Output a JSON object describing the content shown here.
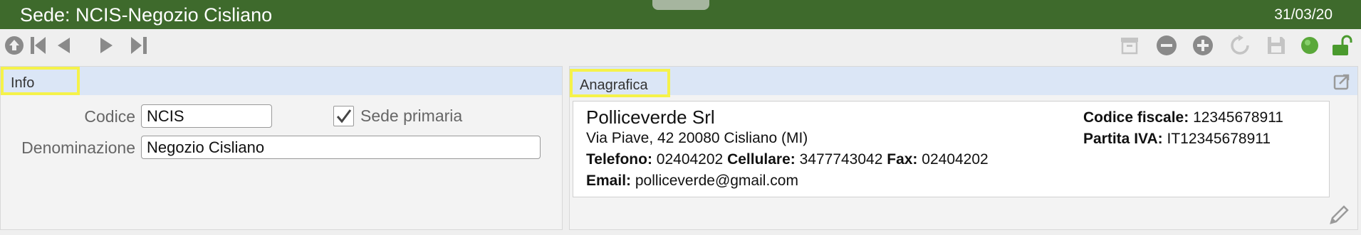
{
  "window": {
    "title": "Sede: NCIS-Negozio Cisliano",
    "date": "31/03/20"
  },
  "toolbar": {
    "left_icons": [
      "up-circle-icon",
      "first-record-icon",
      "previous-record-icon",
      "next-record-icon",
      "last-record-icon"
    ],
    "right_icons": [
      "archive-icon",
      "remove-icon",
      "add-icon",
      "refresh-icon",
      "save-icon",
      "status-indicator-icon",
      "unlock-icon"
    ],
    "colors": {
      "icon_gray": "#8a8a8a",
      "status_green": "#5aa83a"
    }
  },
  "info_panel": {
    "tab_label": "Info",
    "codice_label": "Codice",
    "codice_value": "NCIS",
    "sede_primaria_label": "Sede primaria",
    "sede_primaria_checked": true,
    "denominazione_label": "Denominazione",
    "denominazione_value": "Negozio Cisliano"
  },
  "anagrafica_panel": {
    "tab_label": "Anagrafica",
    "company_name": "Polliceverde Srl",
    "address": "Via Piave, 42 20080 Cisliano (MI)",
    "telefono_label": "Telefono:",
    "telefono_value": "02404202",
    "cellulare_label": "Cellulare:",
    "cellulare_value": "3477743042",
    "fax_label": "Fax:",
    "fax_value": "02404202",
    "email_label": "Email:",
    "email_value": "polliceverde@gmail.com",
    "codice_fiscale_label": "Codice fiscale:",
    "codice_fiscale_value": "12345678911",
    "partita_iva_label": "Partita IVA:",
    "partita_iva_value": "IT12345678911"
  },
  "colors": {
    "titlebar": "#3e6a2c",
    "panel_header": "#dbe6f6",
    "highlight": "#f5f24a"
  }
}
